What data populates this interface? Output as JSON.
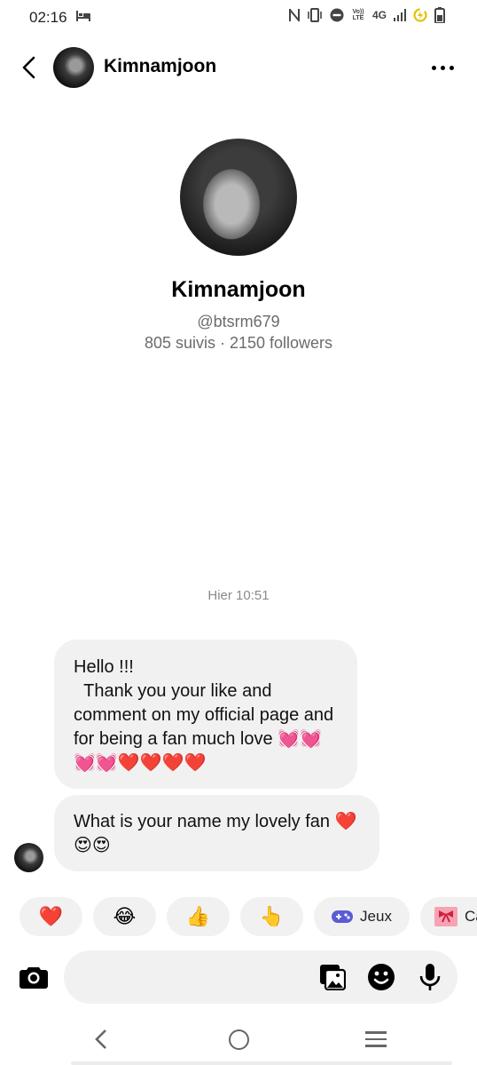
{
  "status_bar": {
    "time": "02:16",
    "icons": [
      "sleep-icon",
      "nfc-icon",
      "vibrate-icon",
      "dnd-icon",
      "volte-icon",
      "network-4g-icon",
      "signal-icon",
      "data-saver-icon",
      "battery-icon"
    ],
    "volte_text": "Vo)) LTE",
    "network_text": "4G"
  },
  "header": {
    "name": "Kimnamjoon",
    "icons": {
      "back": "back-arrow-icon",
      "more": "more-options-icon"
    }
  },
  "profile": {
    "name": "Kimnamjoon",
    "handle": "@btsrm679",
    "stats": "805 suivis · 2150 followers"
  },
  "conversation": {
    "timestamp": "Hier 10:51",
    "messages": [
      {
        "text": "Hello !!!\n  Thank you your like and comment on my official page and for being a fan much love 💓💓💓💓❤️❤️❤️❤️"
      },
      {
        "text": "What is your name my lovely fan ❤️😍😍"
      }
    ]
  },
  "quick_replies": [
    {
      "emoji": "❤️",
      "label": ""
    },
    {
      "emoji": "😂",
      "label": ""
    },
    {
      "emoji": "👍",
      "label": ""
    },
    {
      "emoji": "👆",
      "label": ""
    },
    {
      "emoji": "🎮",
      "label": "Jeux"
    },
    {
      "emoji": "🎀",
      "label": "Ca"
    }
  ],
  "composer": {
    "placeholder": "",
    "icons": [
      "camera-icon",
      "gallery-icon",
      "sticker-icon",
      "microphone-icon"
    ]
  },
  "navigation": {
    "icons": [
      "nav-back-icon",
      "nav-home-icon",
      "nav-recents-icon"
    ]
  },
  "colors": {
    "bubble": "#f1f1f1",
    "text": "#111111",
    "secondary_text": "#6b6b6b",
    "games_icon": "#5b5bd6"
  }
}
